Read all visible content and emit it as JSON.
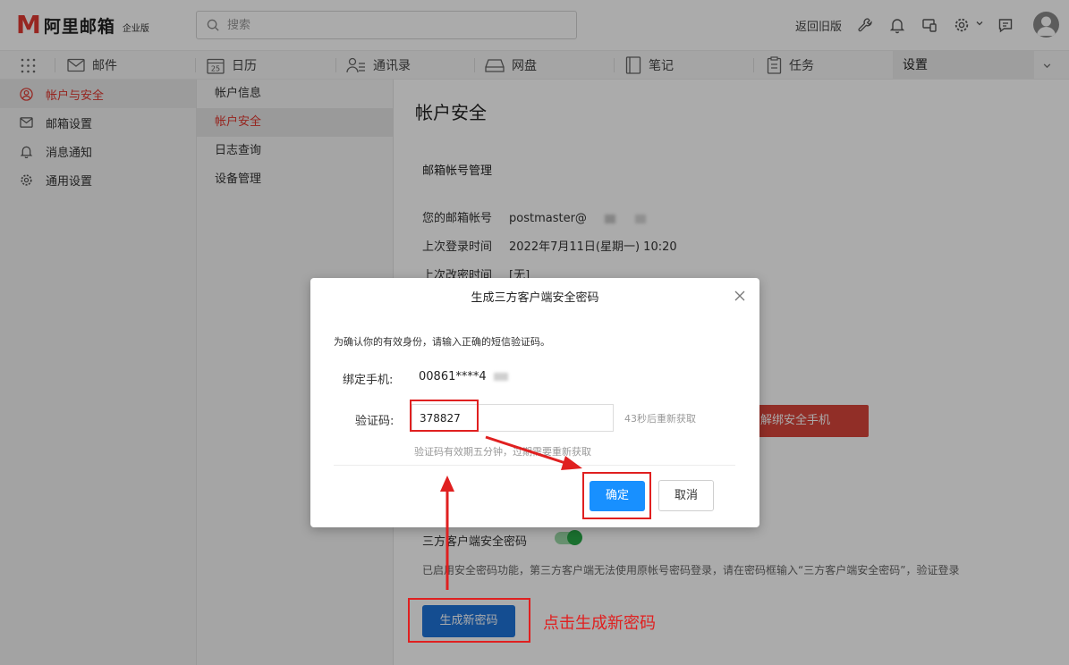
{
  "header": {
    "logo_mark": "M",
    "logo_text": "阿里邮箱",
    "edition": "企业版",
    "search_placeholder": "搜索",
    "old_version_link": "返回旧版"
  },
  "tabs": [
    {
      "label": "邮件",
      "icon": "mail-icon"
    },
    {
      "label": "日历",
      "icon": "calendar-icon",
      "badge": "25"
    },
    {
      "label": "通讯录",
      "icon": "contacts-icon"
    },
    {
      "label": "网盘",
      "icon": "disk-icon"
    },
    {
      "label": "笔记",
      "icon": "note-icon"
    },
    {
      "label": "任务",
      "icon": "task-icon"
    }
  ],
  "active_tab": "设置",
  "settings_nav": [
    {
      "label": "帐户与安全",
      "icon": "user-icon",
      "active": true
    },
    {
      "label": "邮箱设置",
      "icon": "mailbox-icon"
    },
    {
      "label": "消息通知",
      "icon": "bell-icon"
    },
    {
      "label": "通用设置",
      "icon": "gear-icon"
    }
  ],
  "sub_nav": [
    {
      "label": "帐户信息"
    },
    {
      "label": "帐户安全",
      "active": true
    },
    {
      "label": "日志查询"
    },
    {
      "label": "设备管理"
    }
  ],
  "content": {
    "title": "帐户安全",
    "section_title": "邮箱帐号管理",
    "account_label": "您的邮箱帐号",
    "account_value": "postmaster@",
    "last_login_label": "上次登录时间",
    "last_login_value": "2022年7月11日(星期一) 10:20",
    "last_pwd_label": "上次改密时间",
    "last_pwd_value": "[无]",
    "unbind_button": "解绑安全手机",
    "third_party_label": "三方客户端安全密码",
    "third_party_enabled": true,
    "third_party_desc": "已启用安全密码功能，第三方客户端无法使用原帐号密码登录，请在密码框输入“三方客户端安全密码”，验证登录",
    "generate_button": "生成新密码"
  },
  "dialog": {
    "title": "生成三方客户端安全密码",
    "tip": "为确认你的有效身份，请输入正确的短信验证码。",
    "phone_label": "绑定手机:",
    "phone_value": "00861****4",
    "code_label": "验证码:",
    "code_value": "378827",
    "resend_text": "43秒后重新获取",
    "hint": "验证码有效期五分钟，过期需要重新获取",
    "ok_button": "确定",
    "cancel_button": "取消"
  },
  "annotation": {
    "text": "点击生成新密码",
    "color": "#e02020"
  },
  "colors": {
    "brand_red": "#e0362e",
    "primary_blue": "#1890ff",
    "generate_blue": "#1f73d8",
    "toggle_green": "#27a847"
  }
}
